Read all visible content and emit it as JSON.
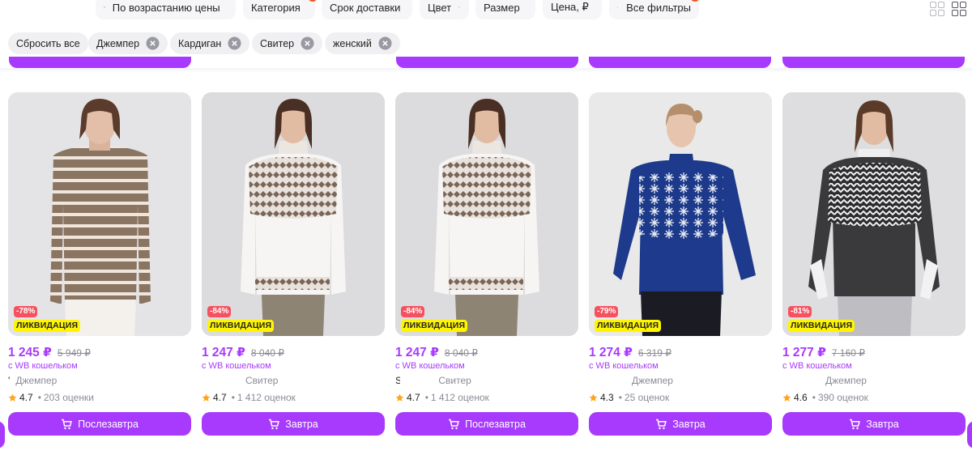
{
  "filters": {
    "sort": {
      "label": "По возрастанию цены",
      "icon": "sort-icon"
    },
    "category": {
      "label": "Категория",
      "count": "3"
    },
    "delivery": {
      "label": "Срок доставки"
    },
    "color": {
      "label": "Цвет"
    },
    "size": {
      "label": "Размер"
    },
    "price": {
      "label": "Цена, ₽"
    },
    "all": {
      "label": "Все фильтры",
      "count": "4",
      "icon": "filters-icon"
    }
  },
  "view_toggles": [
    "grid-large-icon",
    "grid-small-icon"
  ],
  "chips": {
    "reset": "Сбросить все",
    "items": [
      "Джемпер",
      "Кардиган",
      "Свитер",
      "женский"
    ]
  },
  "colors": {
    "accent": "#a73afd",
    "discount": "#f5515f",
    "liquidation": "#fff500"
  },
  "products": [
    {
      "discount": "-78%",
      "badge": "ЛИКВИДАЦИЯ",
      "price": "1 245 ₽",
      "old_price": "5 949 ₽",
      "wallet": "с WB кошельком",
      "brand": "'",
      "name": "Джемпер",
      "rating": "4.7",
      "reviews": "203 оценки",
      "delivery": "Послезавтра"
    },
    {
      "discount": "-84%",
      "badge": "ЛИКВИДАЦИЯ",
      "price": "1 247 ₽",
      "old_price": "8 040 ₽",
      "wallet": "с WB кошельком",
      "brand": "",
      "name": "Свитер",
      "rating": "4.7",
      "reviews": "1 412 оценок",
      "delivery": "Завтра"
    },
    {
      "discount": "-84%",
      "badge": "ЛИКВИДАЦИЯ",
      "price": "1 247 ₽",
      "old_price": "8 040 ₽",
      "wallet": "с WB кошельком",
      "brand": "S",
      "name": "Свитер",
      "rating": "4.7",
      "reviews": "1 412 оценок",
      "delivery": "Послезавтра"
    },
    {
      "discount": "-79%",
      "badge": "ЛИКВИДАЦИЯ",
      "price": "1 274 ₽",
      "old_price": "6 319 ₽",
      "wallet": "с WB кошельком",
      "brand": "",
      "name": "Джемпер",
      "rating": "4.3",
      "reviews": "25 оценок",
      "delivery": "Завтра"
    },
    {
      "discount": "-81%",
      "badge": "ЛИКВИДАЦИЯ",
      "price": "1 277 ₽",
      "old_price": "7 160 ₽",
      "wallet": "с WB кошельком",
      "brand": "",
      "name": "Джемпер",
      "rating": "4.6",
      "reviews": "390 оценок",
      "delivery": "Завтра"
    }
  ]
}
